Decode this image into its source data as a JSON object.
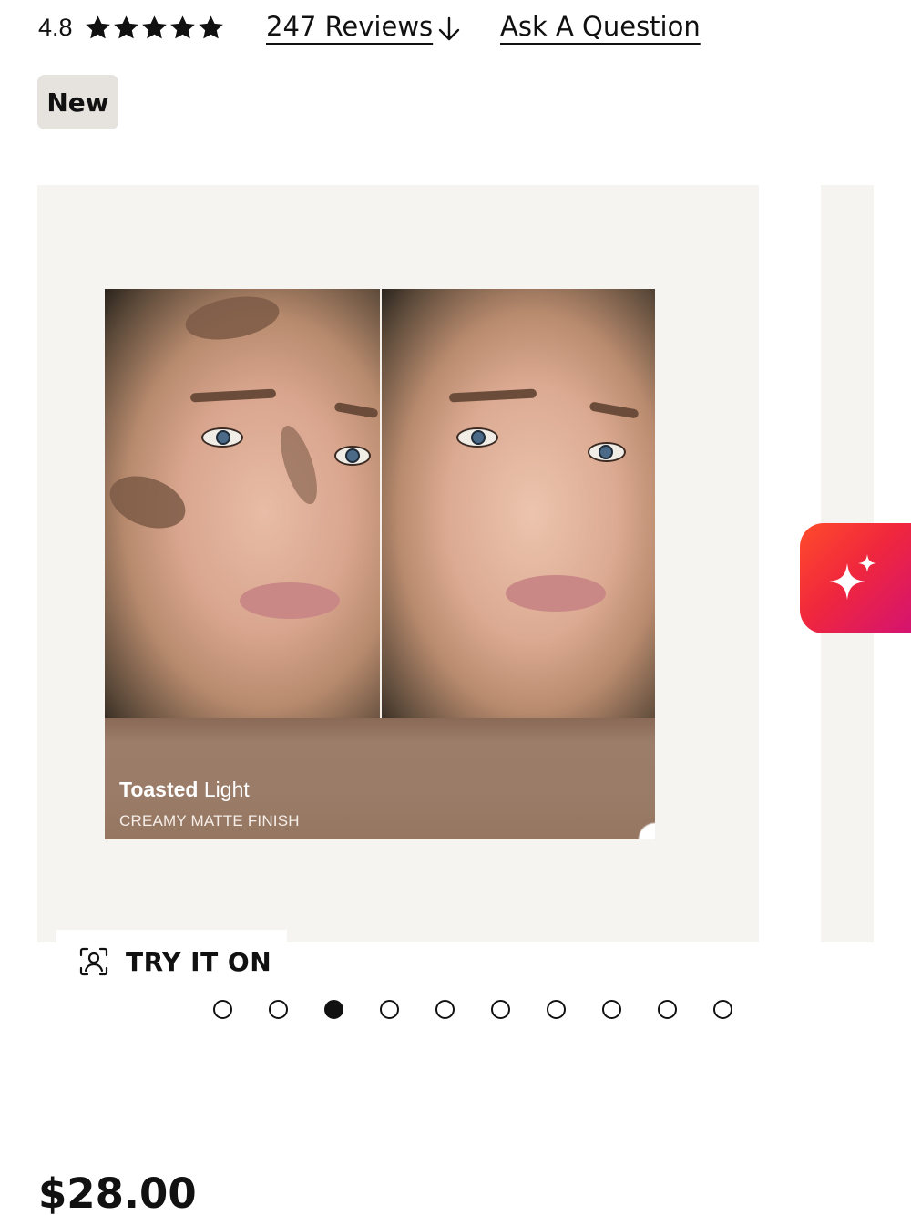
{
  "rating": {
    "value": "4.8",
    "stars_filled": 5,
    "stars_total": 5,
    "reviews_label": "247 Reviews",
    "ask_label": "Ask A Question"
  },
  "badge": {
    "label": "New"
  },
  "gallery": {
    "shade_name_bold": "Toasted",
    "shade_name_light": "Light",
    "shade_finish": "CREAMY MATTE FINISH",
    "try_on_label": "TRY IT ON",
    "dot_count": 10,
    "active_dot_index": 2
  },
  "price": "$28.00",
  "colors": {
    "gallery_bg": "#f6f4f1",
    "badge_bg": "#e6e3df",
    "ai_button_gradient_start": "#ff4b2b",
    "ai_button_gradient_end": "#d21273"
  },
  "icons": {
    "star": "star-icon",
    "arrow": "arrow-down-icon",
    "try_on": "face-scan-icon",
    "ai": "sparkle-icon"
  }
}
